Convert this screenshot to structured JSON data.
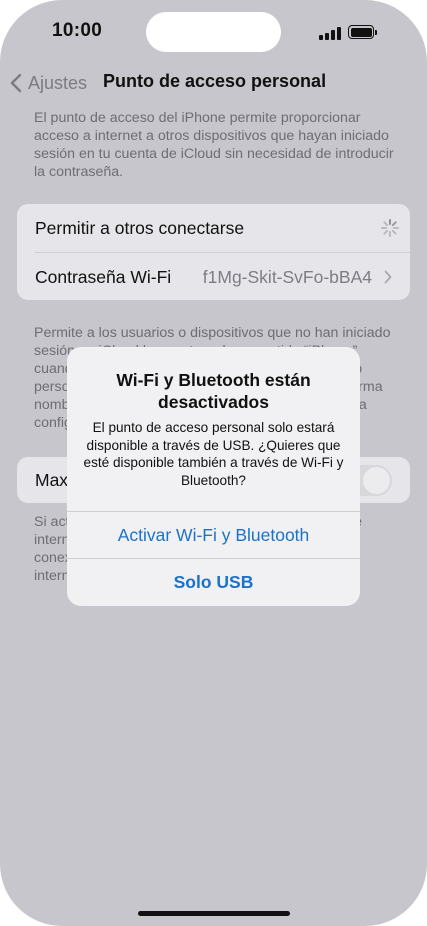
{
  "status_bar": {
    "time": "10:00"
  },
  "nav": {
    "back_label": "Ajustes",
    "title": "Punto de acceso personal"
  },
  "hotspot": {
    "description": "El punto de acceso del iPhone permite proporcionar acceso a internet a otros dispositivos que hayan iniciado sesión en tu cuenta de iCloud sin necesidad de introducir la contraseña.",
    "allow_others_label": "Permitir a otros conectarse",
    "wifi_password_label": "Contraseña Wi-Fi",
    "wifi_password_value": "f1Mg-Skit-SvFo-bBA4",
    "family_description": "Permite a los usuarios o dispositivos que no han iniciado sesión en iCloud buscar tu red compartida “iPhone” cuando el punto de acceso esté activo. Para acceso personal, tendrás que introducir la contraseña de forma nombre de contraseña manual de compartir desde la configuración de red o cuenta.",
    "maximize_label": "Maximizar compatibilidad",
    "maximize_description": "Si activas esta opción, se reducirá el rendimiento de internet de los dispositivos que se conectan a él o conexión con este iPhone con el punto de acceso a internet."
  },
  "alert": {
    "title": "Wi-Fi y Bluetooth están desactivados",
    "message": "El punto de acceso personal solo estará disponible a través de USB. ¿Quieres que esté disponible también a través de Wi-Fi y Bluetooth?",
    "primary_button": "Activar Wi-Fi y Bluetooth",
    "secondary_button": "Solo USB"
  },
  "colors": {
    "accent": "#1a73c8",
    "background": "#c7c6cc",
    "alert_background": "#f1f0f2"
  }
}
